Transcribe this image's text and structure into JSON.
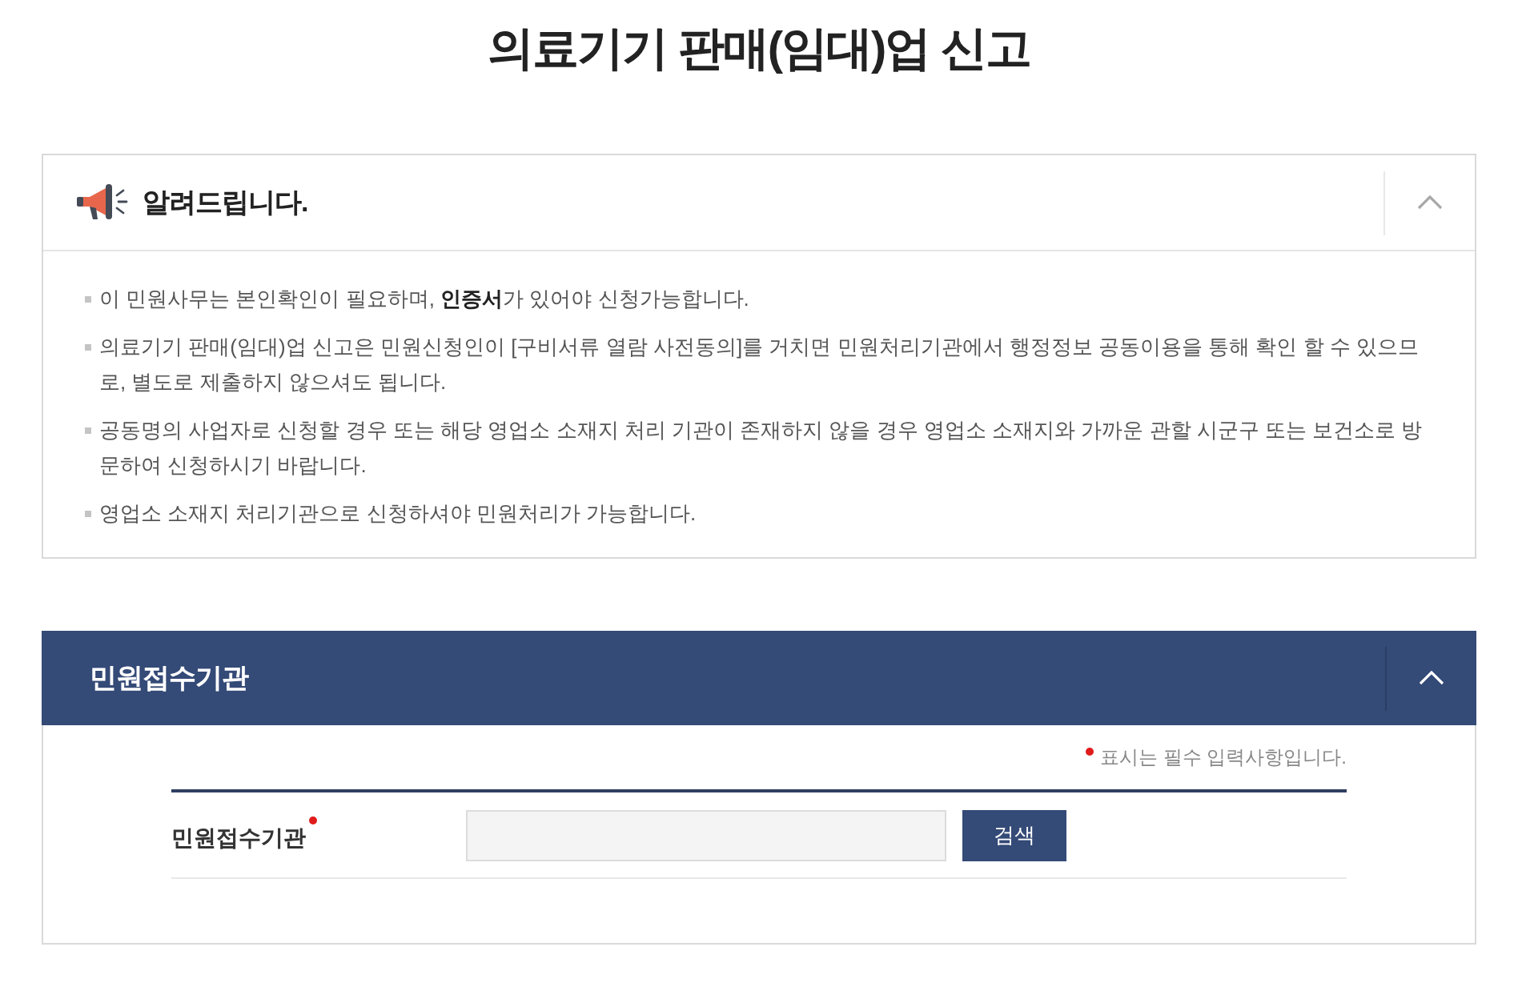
{
  "page": {
    "title": "의료기기 판매(임대)업 신고"
  },
  "notice": {
    "title": "알려드립니다.",
    "expanded": true,
    "items": [
      "이 민원사무는 본인확인이 필요하며, **인증서**가 있어야 신청가능합니다.",
      "의료기기 판매(임대)업 신고은 민원신청인이 [구비서류 열람 사전동의]를 거치면 민원처리기관에서 행정정보 공동이용을 통해 확인 할 수 있으므로, 별도로 제출하지 않으셔도 됩니다.",
      "공동명의 사업자로 신청할 경우 또는 해당 영업소 소재지 처리 기관이 존재하지 않을 경우 영업소 소재지와 가까운 관할 시군구 또는 보건소로 방문하여 신청하시기 바랍니다.",
      "영업소 소재지 처리기관으로 신청하셔야 민원처리가 가능합니다."
    ]
  },
  "reception": {
    "title": "민원접수기관",
    "expanded": true,
    "required_note": "표시는 필수 입력사항입니다.",
    "fields": [
      {
        "label": "민원접수기관",
        "required": true,
        "button": "검색"
      }
    ]
  }
}
